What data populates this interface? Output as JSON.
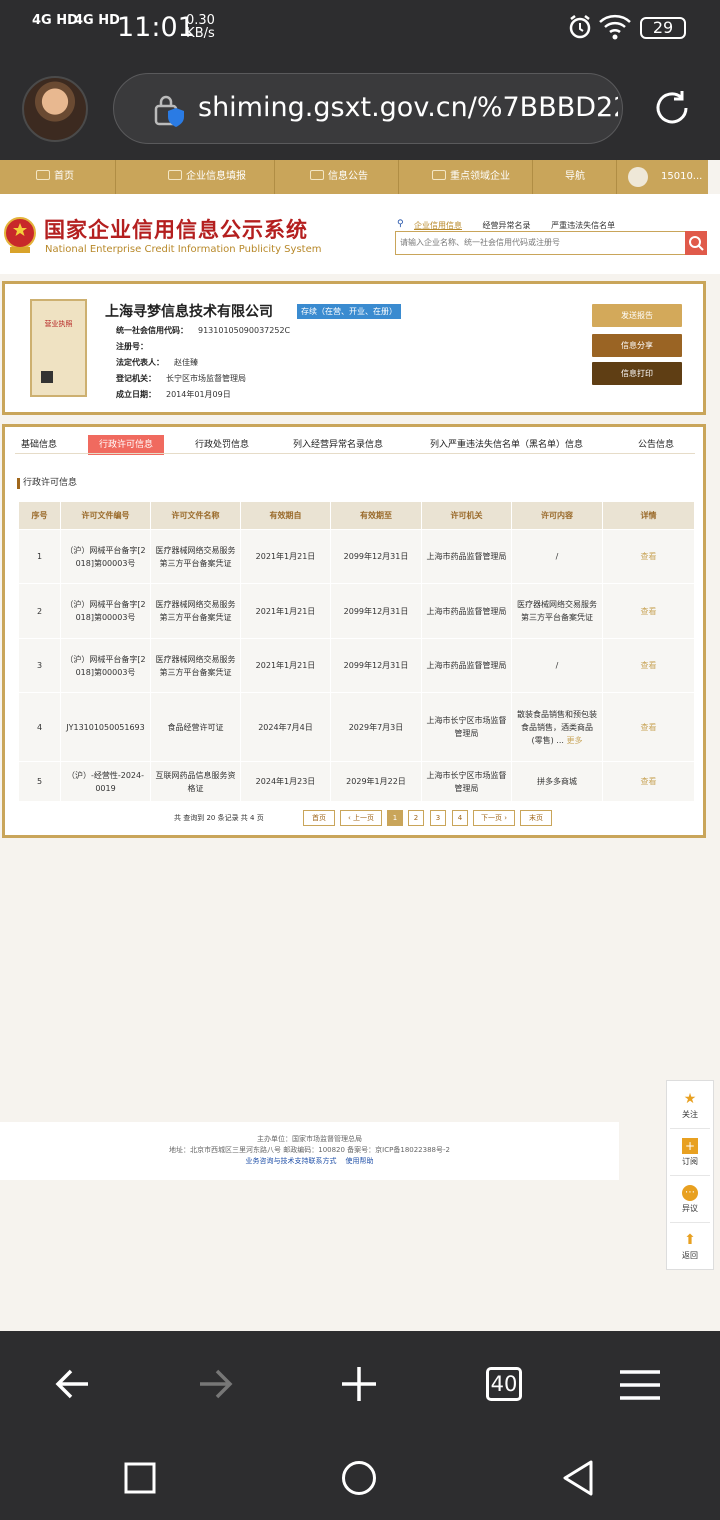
{
  "status_bar": {
    "net1": "4G HD",
    "net2": "4G HD",
    "time": "11:01",
    "speed_value": "0.30",
    "speed_unit": "KB/s",
    "battery": "29"
  },
  "browser": {
    "url": "shiming.gsxt.gov.cn/%7BBBD22",
    "tab_count": "40"
  },
  "nav": {
    "items": [
      "首页",
      "企业信息填报",
      "信息公告",
      "重点领域企业",
      "导航"
    ],
    "user": "15010..."
  },
  "header": {
    "title": "国家企业信用信息公示系统",
    "subtitle": "National Enterprise Credit Information Publicity System",
    "search_tabs": [
      "企业信用信息",
      "经营异常名录",
      "严重违法失信名单"
    ],
    "search_placeholder": "请输入企业名称、统一社会信用代码或注册号"
  },
  "company": {
    "license_label": "营业执照",
    "name": "上海寻梦信息技术有限公司",
    "status": "存续（在营、开业、在册）",
    "fields": [
      {
        "label": "统一社会信用代码：",
        "value": "91310105090037252C"
      },
      {
        "label": "注册号：",
        "value": ""
      },
      {
        "label": "法定代表人：",
        "value": "赵佳臻"
      },
      {
        "label": "登记机关：",
        "value": "长宁区市场监督管理局"
      },
      {
        "label": "成立日期：",
        "value": "2014年01月09日"
      }
    ],
    "buttons": [
      "发送报告",
      "信息分享",
      "信息打印"
    ]
  },
  "tabs": [
    "基础信息",
    "行政许可信息",
    "行政处罚信息",
    "列入经营异常名录信息",
    "列入严重违法失信名单（黑名单）信息",
    "公告信息"
  ],
  "section_title": "行政许可信息",
  "table": {
    "headers": [
      "序号",
      "许可文件编号",
      "许可文件名称",
      "有效期自",
      "有效期至",
      "许可机关",
      "许可内容",
      "详情"
    ],
    "rows": [
      [
        "1",
        "（沪）网械平台备字[2018]第00003号",
        "医疗器械网络交易服务第三方平台备案凭证",
        "2021年1月21日",
        "2099年12月31日",
        "上海市药品监督管理局",
        "/",
        "查看"
      ],
      [
        "2",
        "（沪）网械平台备字[2018]第00003号",
        "医疗器械网络交易服务第三方平台备案凭证",
        "2021年1月21日",
        "2099年12月31日",
        "上海市药品监督管理局",
        "医疗器械网络交易服务第三方平台备案凭证",
        "查看"
      ],
      [
        "3",
        "（沪）网械平台备字[2018]第00003号",
        "医疗器械网络交易服务第三方平台备案凭证",
        "2021年1月21日",
        "2099年12月31日",
        "上海市药品监督管理局",
        "/",
        "查看"
      ],
      [
        "4",
        "JY13101050051693",
        "食品经营许可证",
        "2024年7月4日",
        "2029年7月3日",
        "上海市长宁区市场监督管理局",
        "散装食品销售和预包装食品销售，酒类商品(零售) ...",
        "查看"
      ],
      [
        "5",
        "（沪）-经营性-2024-0019",
        "互联网药品信息服务资格证",
        "2024年1月23日",
        "2029年1月22日",
        "上海市长宁区市场监督管理局",
        "拼多多商城",
        "查看"
      ]
    ],
    "more_label": "更多"
  },
  "pager": {
    "summary": "共 查询到 20 条记录 共 4 页",
    "first": "首页",
    "prev": "‹ 上一页",
    "pages": [
      "1",
      "2",
      "3",
      "4"
    ],
    "next": "下一页 ›",
    "last": "末页"
  },
  "footer": {
    "line1": "主办单位：国家市场监督管理总局",
    "line2": "地址：北京市西城区三里河东路八号   邮政编码：100820   备案号：京ICP备18022388号-2",
    "link1": "业务咨询与技术支持联系方式",
    "link2": "使用帮助"
  },
  "side": [
    "关注",
    "订阅",
    "异议",
    "返回"
  ],
  "colors": {
    "gold": "#c9a55a",
    "red": "#b41f1f",
    "active_tab": "#f06a5f",
    "brown": "#8a5a1e"
  }
}
